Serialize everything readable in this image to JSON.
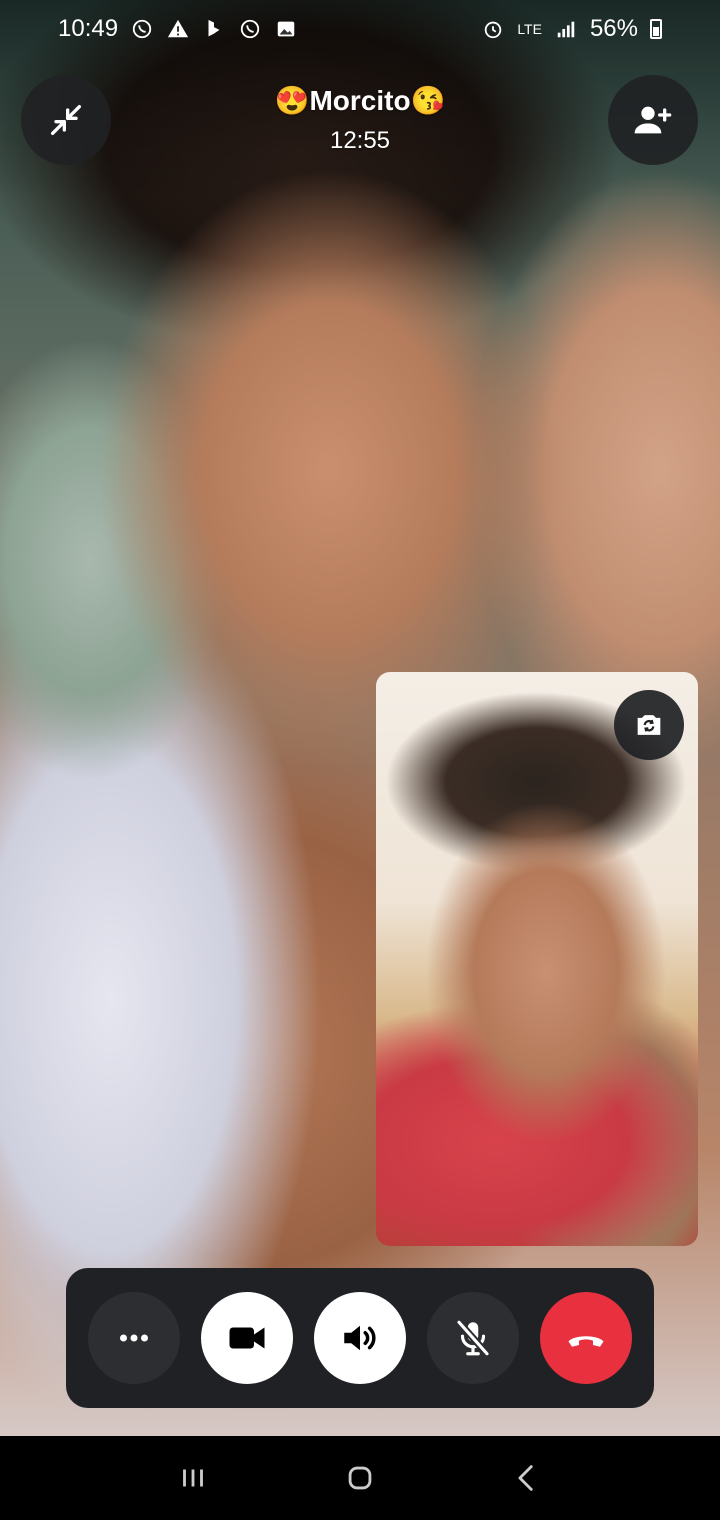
{
  "status_bar": {
    "time": "10:49",
    "network": "LTE",
    "battery_percent": "56%",
    "notification_icons": [
      "whatsapp-icon",
      "alert-icon",
      "bing-icon",
      "whatsapp-icon",
      "image-icon"
    ],
    "system_icons": [
      "alarm-icon",
      "lte-icon",
      "signal-icon",
      "battery-icon"
    ]
  },
  "call": {
    "title": "😍Morcito😘",
    "timer": "12:55"
  },
  "top_controls": {
    "minimize_icon": "minimize-icon",
    "add_person_icon": "add-person-icon"
  },
  "self_view": {
    "flip_camera_icon": "flip-camera-icon"
  },
  "controls": [
    {
      "name": "more-options",
      "icon": "more-icon",
      "style": "dark"
    },
    {
      "name": "video-toggle",
      "icon": "video-camera-icon",
      "style": "light"
    },
    {
      "name": "speaker-toggle",
      "icon": "speaker-icon",
      "style": "light"
    },
    {
      "name": "mute-toggle",
      "icon": "mic-off-icon",
      "style": "dark"
    },
    {
      "name": "end-call",
      "icon": "hang-up-icon",
      "style": "red"
    }
  ],
  "colors": {
    "control_bar": "#1f2124",
    "end_call": "#e8303f",
    "button_light": "#ffffff",
    "button_dark": "#2c2e32"
  },
  "nav_bar": [
    "recent-apps-icon",
    "home-icon",
    "back-icon"
  ]
}
